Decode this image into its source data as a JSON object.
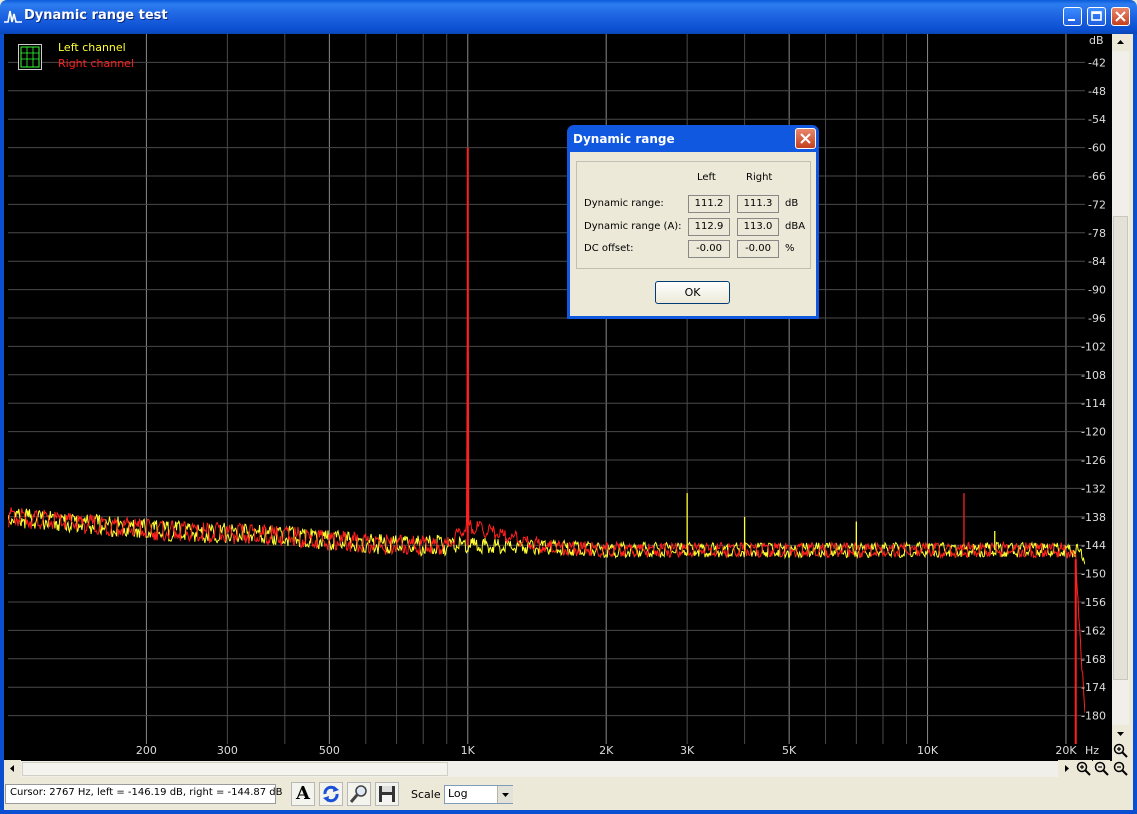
{
  "window": {
    "title": "Dynamic range test"
  },
  "legend": {
    "left": "Left channel",
    "right": "Right channel",
    "left_color": "#ffff33",
    "right_color": "#ff2020"
  },
  "y_axis": {
    "unit": "dB",
    "ticks": [
      "-42",
      "-48",
      "-54",
      "-60",
      "-66",
      "-72",
      "-78",
      "-84",
      "-90",
      "-96",
      "-102",
      "-108",
      "-114",
      "-120",
      "-126",
      "-132",
      "-138",
      "-144",
      "-150",
      "-156",
      "-162",
      "-168",
      "-174",
      "-180"
    ]
  },
  "x_axis": {
    "unit": "Hz",
    "ticks": [
      "200",
      "300",
      "500",
      "1K",
      "2K",
      "3K",
      "5K",
      "10K",
      "20K"
    ]
  },
  "chart_data": {
    "type": "line",
    "xscale": "log",
    "xlim": [
      100,
      22000
    ],
    "ylim": [
      -186,
      -36
    ],
    "xlabel": "Hz",
    "ylabel": "dB",
    "grid": true,
    "legend_position": "top-left",
    "series": [
      {
        "name": "Left channel",
        "color": "#ffff33",
        "x": [
          100,
          130,
          170,
          220,
          300,
          400,
          500,
          700,
          900,
          1000,
          1500,
          2000,
          2500,
          3000,
          4000,
          5000,
          6000,
          7000,
          8000,
          10000,
          12000,
          15000,
          18000,
          20000,
          21000,
          22000
        ],
        "y": [
          -138,
          -139,
          -140,
          -141,
          -141.5,
          -142,
          -143,
          -144,
          -144,
          -144,
          -144.5,
          -145,
          -145,
          -145,
          -145,
          -145,
          -145,
          -145,
          -145,
          -145,
          -145,
          -145,
          -145,
          -145,
          -145,
          -147
        ]
      },
      {
        "name": "Right channel",
        "color": "#ff2020",
        "x": [
          100,
          130,
          170,
          220,
          300,
          400,
          500,
          700,
          900,
          995,
          1000,
          1005,
          1500,
          2000,
          2500,
          3000,
          4000,
          5000,
          6000,
          7000,
          8000,
          10000,
          12000,
          15000,
          18000,
          20000,
          21000,
          22000
        ],
        "y": [
          -138,
          -139,
          -140,
          -141,
          -141.5,
          -142,
          -143,
          -144,
          -144,
          -140,
          -60,
          -140,
          -144.5,
          -145,
          -145,
          -145,
          -145,
          -145,
          -145,
          -145,
          -145,
          -145,
          -145,
          -145,
          -145,
          -145,
          -147,
          -180
        ]
      }
    ],
    "spurs": [
      {
        "channel": "Left channel",
        "x": 3000,
        "y": -133
      },
      {
        "channel": "Left channel",
        "x": 4000,
        "y": -138
      },
      {
        "channel": "Left channel",
        "x": 7000,
        "y": -139
      },
      {
        "channel": "Left channel",
        "x": 14000,
        "y": -141
      },
      {
        "channel": "Right channel",
        "x": 12000,
        "y": -133
      }
    ]
  },
  "dialog": {
    "title": "Dynamic range",
    "col_left": "Left",
    "col_right": "Right",
    "rows": [
      {
        "label": "Dynamic range:",
        "left": "111.2",
        "right": "111.3",
        "unit": "dB"
      },
      {
        "label": "Dynamic range (A):",
        "left": "112.9",
        "right": "113.0",
        "unit": "dBA"
      },
      {
        "label": "DC offset:",
        "left": "-0.00",
        "right": "-0.00",
        "unit": "%"
      }
    ],
    "ok": "OK"
  },
  "status": {
    "cursor": "Cursor:  2767 Hz,  left = -146.19 dB,  right = -144.87 dB"
  },
  "toolbar": {
    "scale_label": "Scale",
    "scale_value": "Log",
    "text_button": "A"
  }
}
